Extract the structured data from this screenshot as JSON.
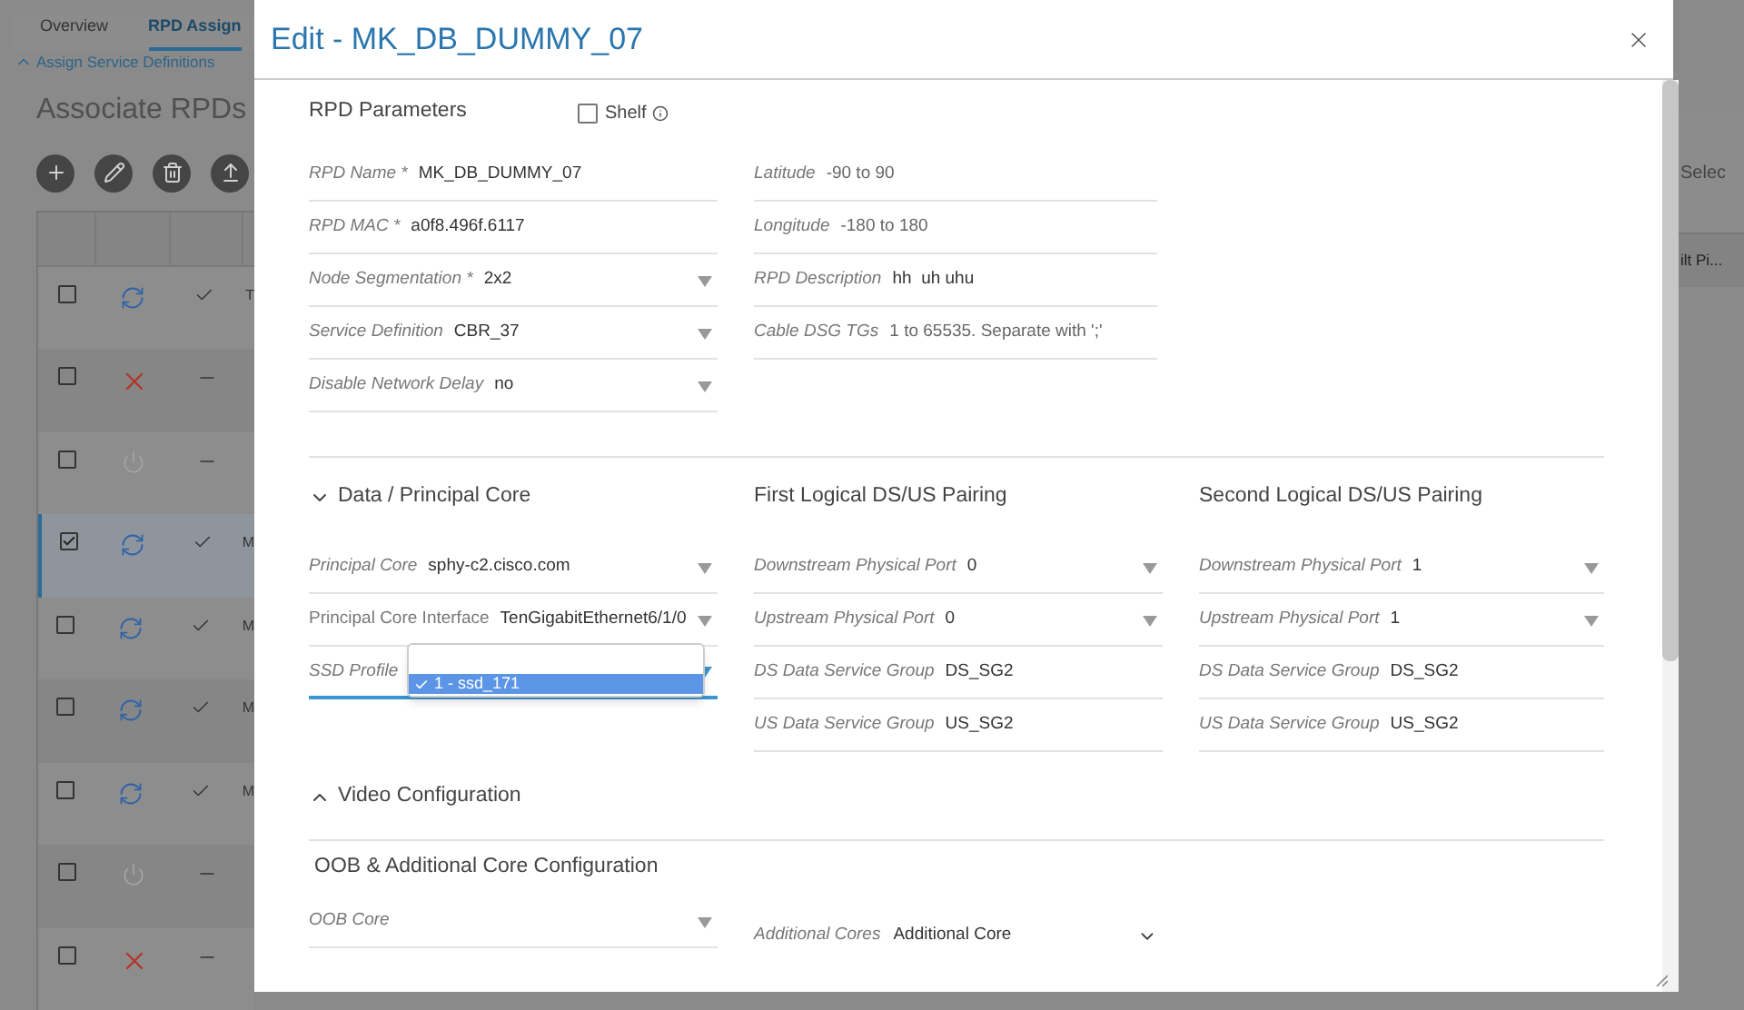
{
  "background": {
    "tabs": [
      {
        "label": "Overview",
        "selected": false
      },
      {
        "label": "RPD Assign",
        "selected": true
      }
    ],
    "link": "Assign Service Definitions",
    "heading": "Associate RPDs",
    "rows": [
      {
        "checked": false,
        "selected": false,
        "kind": "sync",
        "assigned": true,
        "name": "T"
      },
      {
        "checked": false,
        "selected": false,
        "kind": "error",
        "assigned": false
      },
      {
        "checked": false,
        "selected": false,
        "kind": "off",
        "assigned": false
      },
      {
        "checked": true,
        "selected": true,
        "kind": "sync",
        "assigned": true,
        "name": "M"
      },
      {
        "checked": false,
        "selected": false,
        "kind": "sync",
        "assigned": true,
        "name": "M"
      },
      {
        "checked": false,
        "selected": false,
        "kind": "sync",
        "assigned": true,
        "name": "M"
      },
      {
        "checked": false,
        "selected": false,
        "kind": "sync",
        "assigned": true,
        "name": "M"
      },
      {
        "checked": false,
        "selected": false,
        "kind": "off",
        "assigned": false
      },
      {
        "checked": false,
        "selected": false,
        "kind": "error",
        "assigned": false
      }
    ],
    "right_texts": [
      "Selec",
      "ilt Pi..."
    ]
  },
  "modal": {
    "title": "Edit - MK_DB_DUMMY_07",
    "rpd_parameters": {
      "title": "RPD Parameters",
      "shelf": {
        "label": "Shelf",
        "checked": false
      },
      "left_fields": [
        {
          "kind": "text",
          "label": "RPD Name *",
          "value": "MK_DB_DUMMY_07"
        },
        {
          "kind": "text",
          "label": "RPD MAC *",
          "value": "a0f8.496f.6117"
        },
        {
          "kind": "select",
          "label": "Node Segmentation *",
          "value": "2x2"
        },
        {
          "kind": "select",
          "label": "Service Definition",
          "value": "CBR_37"
        },
        {
          "kind": "select",
          "label": "Disable Network Delay",
          "value": "no"
        }
      ],
      "right_fields": [
        {
          "kind": "text",
          "label": "Latitude",
          "placeholder": "-90 to 90"
        },
        {
          "kind": "text",
          "label": "Longitude",
          "placeholder": "-180 to 180"
        },
        {
          "kind": "text",
          "label": "RPD Description",
          "value": "hh  uh uhu"
        },
        {
          "kind": "text",
          "label": "Cable DSG TGs",
          "placeholder": "1 to 65535. Separate with ';'"
        }
      ]
    },
    "data_core": {
      "title": "Data / Principal Core",
      "expanded": true,
      "fields": [
        {
          "kind": "select",
          "label": "Principal Core",
          "value": "sphy-c2.cisco.com"
        },
        {
          "kind": "select",
          "label": "Principal Core Interface",
          "value": "TenGigabitEthernet6/1/0"
        },
        {
          "kind": "select",
          "label": "SSD Profile",
          "focused": true,
          "dropdown": {
            "options": [
              {
                "label": "1 - ssd_171",
                "selected": true
              }
            ]
          }
        }
      ]
    },
    "pairings": [
      {
        "title": "First Logical DS/US Pairing",
        "fields": [
          {
            "kind": "select",
            "label": "Downstream Physical Port",
            "value": "0"
          },
          {
            "kind": "select",
            "label": "Upstream Physical Port",
            "value": "0"
          },
          {
            "kind": "text",
            "label": "DS Data Service Group",
            "value": "DS_SG2"
          },
          {
            "kind": "text",
            "label": "US Data Service Group",
            "value": "US_SG2"
          }
        ]
      },
      {
        "title": "Second Logical DS/US Pairing",
        "fields": [
          {
            "kind": "select",
            "label": "Downstream Physical Port",
            "value": "1"
          },
          {
            "kind": "select",
            "label": "Upstream Physical Port",
            "value": "1"
          },
          {
            "kind": "text",
            "label": "DS Data Service Group",
            "value": "DS_SG2"
          },
          {
            "kind": "text",
            "label": "US Data Service Group",
            "value": "US_SG2"
          }
        ]
      }
    ],
    "video": {
      "title": "Video Configuration",
      "expanded": false
    },
    "oob": {
      "title": "OOB & Additional Core Configuration",
      "oob_core": {
        "kind": "select",
        "label": "OOB Core"
      },
      "additional_cores": {
        "label": "Additional Cores",
        "value": "Additional Core"
      }
    }
  }
}
